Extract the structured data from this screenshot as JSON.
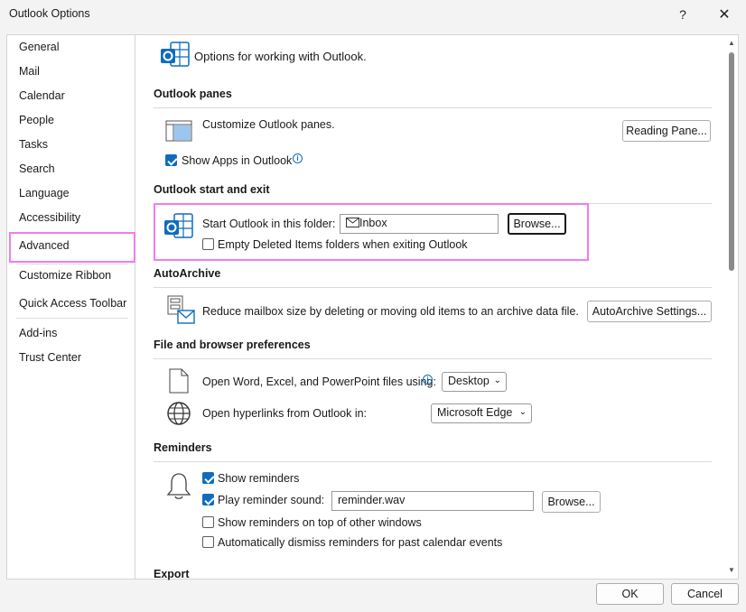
{
  "window": {
    "title": "Outlook Options",
    "help_glyph": "?",
    "close_glyph": "✕"
  },
  "sidebar": {
    "items": [
      {
        "label": "General"
      },
      {
        "label": "Mail"
      },
      {
        "label": "Calendar"
      },
      {
        "label": "People"
      },
      {
        "label": "Tasks"
      },
      {
        "label": "Search"
      },
      {
        "label": "Language"
      },
      {
        "label": "Accessibility"
      },
      {
        "label": "Advanced",
        "selected": true
      },
      {
        "label": "Customize Ribbon"
      },
      {
        "label": "Quick Access Toolbar"
      },
      {
        "label": "Add-ins"
      },
      {
        "label": "Trust Center"
      }
    ]
  },
  "header": {
    "text": "Options for working with Outlook."
  },
  "outlook_panes": {
    "title": "Outlook panes",
    "customize_text": "Customize Outlook panes.",
    "reading_pane_button": "Reading Pane...",
    "show_apps_label": "Show Apps in Outlook",
    "show_apps_checked": true
  },
  "start_exit": {
    "title": "Outlook start and exit",
    "start_folder_label": "Start Outlook in this folder:",
    "start_folder_value": "Inbox",
    "browse_button": "Browse...",
    "empty_deleted_label": "Empty Deleted Items folders when exiting Outlook",
    "empty_deleted_checked": false
  },
  "autoarchive": {
    "title": "AutoArchive",
    "description": "Reduce mailbox size by deleting or moving old items to an archive data file.",
    "settings_button": "AutoArchive Settings..."
  },
  "file_browser": {
    "title": "File and browser preferences",
    "open_files_label": "Open Word, Excel, and PowerPoint files using:",
    "open_files_value": "Desktop",
    "hyperlinks_label": "Open hyperlinks from Outlook in:",
    "hyperlinks_value": "Microsoft Edge"
  },
  "reminders": {
    "title": "Reminders",
    "show_reminders_label": "Show reminders",
    "show_reminders_checked": true,
    "play_sound_label": "Play reminder sound:",
    "play_sound_checked": true,
    "sound_file": "reminder.wav",
    "browse_button": "Browse...",
    "on_top_label": "Show reminders on top of other windows",
    "on_top_checked": false,
    "auto_dismiss_label": "Automatically dismiss reminders for past calendar events",
    "auto_dismiss_checked": false
  },
  "export": {
    "title": "Export"
  },
  "footer": {
    "ok_button": "OK",
    "cancel_button": "Cancel"
  },
  "colors": {
    "accent": "#0f6cbd",
    "highlight": "#f07cf0",
    "outlook_blue": "#0f6cbd"
  }
}
